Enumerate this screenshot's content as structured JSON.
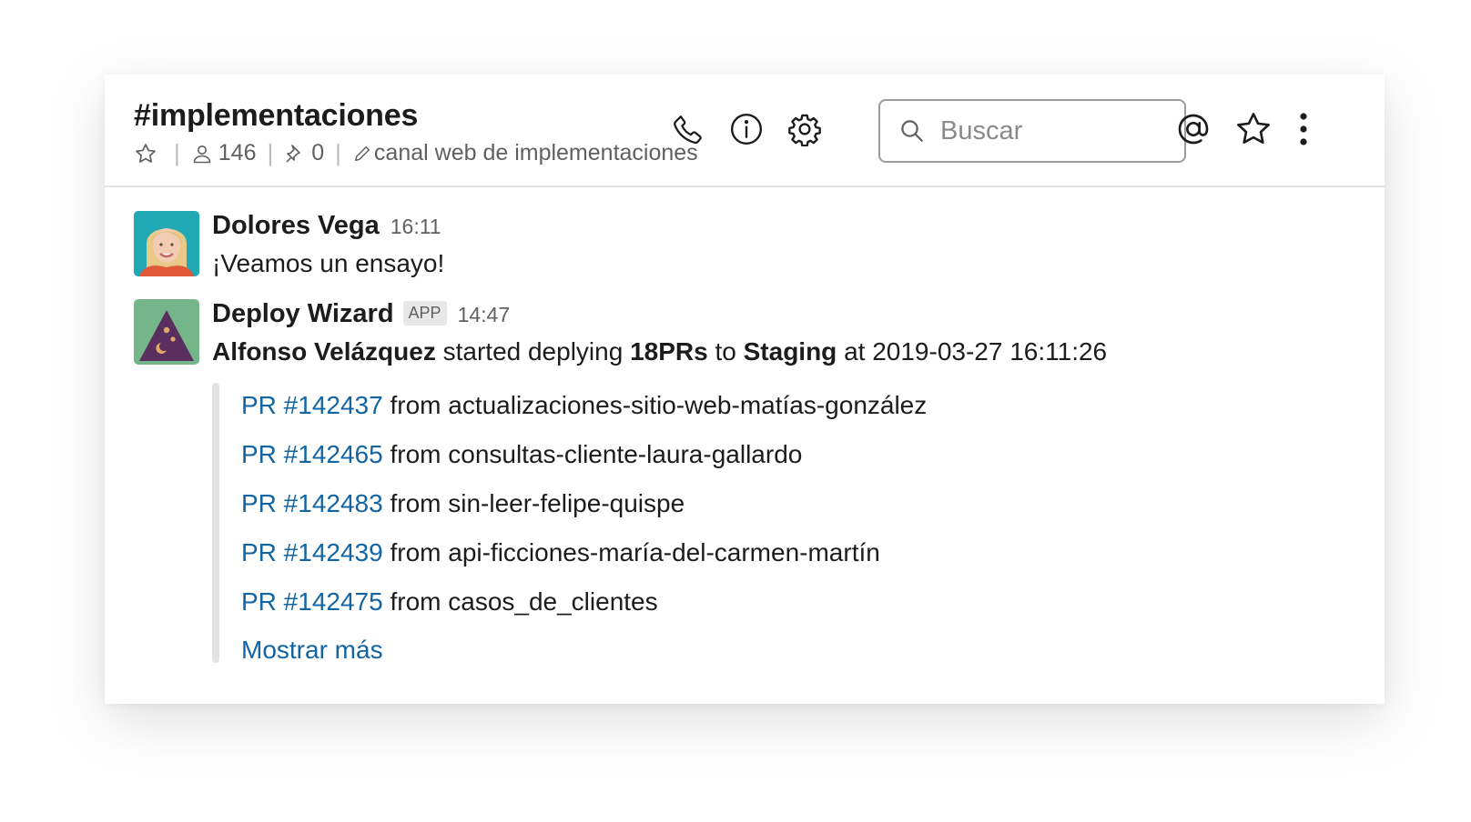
{
  "channel": {
    "name": "#implementaciones",
    "member_count": "146",
    "pinned_count": "0",
    "topic": "canal web de implementaciones"
  },
  "search": {
    "placeholder": "Buscar",
    "value": ""
  },
  "messages": [
    {
      "author": "Dolores Vega",
      "time": "16:11",
      "text": "¡Veamos un ensayo!"
    },
    {
      "author": "Deploy Wizard",
      "badge": "APP",
      "time": "14:47",
      "text_parts": {
        "user": "Alfonso Velázquez",
        "action": " started deplying ",
        "count": "18PRs",
        "to": " to ",
        "env": "Staging",
        "at": " at 2019-03-27 16:11:26"
      },
      "prs": [
        {
          "link": "PR #142437",
          "from": " from actualizaciones-sitio-web-matías-gonzález"
        },
        {
          "link": "PR #142465",
          "from": " from consultas-cliente-laura-gallardo"
        },
        {
          "link": "PR #142483",
          "from": " from sin-leer-felipe-quispe"
        },
        {
          "link": "PR #142439",
          "from": " from api-ficciones-maría-del-carmen-martín"
        },
        {
          "link": "PR #142475",
          "from": " from casos_de_clientes"
        }
      ],
      "show_more": "Mostrar más"
    }
  ],
  "colors": {
    "link": "#1264a3",
    "text": "#1d1c1d",
    "muted": "#616061",
    "wizard_bg": "#74b58a",
    "wizard_hat": "#5a2e5e",
    "wizard_stars": "#e0a96a"
  },
  "icons": [
    "star-icon",
    "person-icon",
    "pin-icon",
    "pencil-icon",
    "phone-icon",
    "info-icon",
    "gear-icon",
    "search-icon",
    "at-icon",
    "star-icon",
    "more-vertical-icon"
  ]
}
